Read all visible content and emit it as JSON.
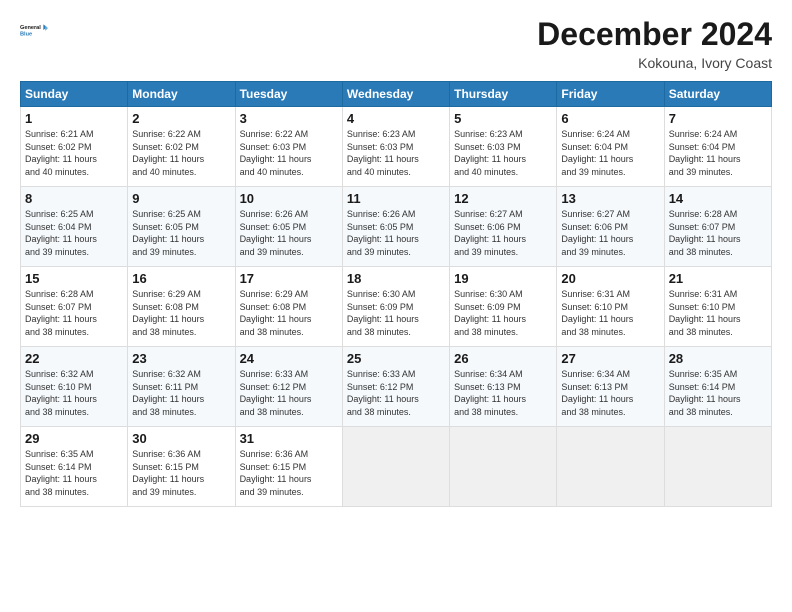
{
  "logo": {
    "line1": "General",
    "line2": "Blue"
  },
  "title": "December 2024",
  "subtitle": "Kokouna, Ivory Coast",
  "days_header": [
    "Sunday",
    "Monday",
    "Tuesday",
    "Wednesday",
    "Thursday",
    "Friday",
    "Saturday"
  ],
  "weeks": [
    [
      {
        "day": "1",
        "info": "Sunrise: 6:21 AM\nSunset: 6:02 PM\nDaylight: 11 hours\nand 40 minutes."
      },
      {
        "day": "2",
        "info": "Sunrise: 6:22 AM\nSunset: 6:02 PM\nDaylight: 11 hours\nand 40 minutes."
      },
      {
        "day": "3",
        "info": "Sunrise: 6:22 AM\nSunset: 6:03 PM\nDaylight: 11 hours\nand 40 minutes."
      },
      {
        "day": "4",
        "info": "Sunrise: 6:23 AM\nSunset: 6:03 PM\nDaylight: 11 hours\nand 40 minutes."
      },
      {
        "day": "5",
        "info": "Sunrise: 6:23 AM\nSunset: 6:03 PM\nDaylight: 11 hours\nand 40 minutes."
      },
      {
        "day": "6",
        "info": "Sunrise: 6:24 AM\nSunset: 6:04 PM\nDaylight: 11 hours\nand 39 minutes."
      },
      {
        "day": "7",
        "info": "Sunrise: 6:24 AM\nSunset: 6:04 PM\nDaylight: 11 hours\nand 39 minutes."
      }
    ],
    [
      {
        "day": "8",
        "info": "Sunrise: 6:25 AM\nSunset: 6:04 PM\nDaylight: 11 hours\nand 39 minutes."
      },
      {
        "day": "9",
        "info": "Sunrise: 6:25 AM\nSunset: 6:05 PM\nDaylight: 11 hours\nand 39 minutes."
      },
      {
        "day": "10",
        "info": "Sunrise: 6:26 AM\nSunset: 6:05 PM\nDaylight: 11 hours\nand 39 minutes."
      },
      {
        "day": "11",
        "info": "Sunrise: 6:26 AM\nSunset: 6:05 PM\nDaylight: 11 hours\nand 39 minutes."
      },
      {
        "day": "12",
        "info": "Sunrise: 6:27 AM\nSunset: 6:06 PM\nDaylight: 11 hours\nand 39 minutes."
      },
      {
        "day": "13",
        "info": "Sunrise: 6:27 AM\nSunset: 6:06 PM\nDaylight: 11 hours\nand 39 minutes."
      },
      {
        "day": "14",
        "info": "Sunrise: 6:28 AM\nSunset: 6:07 PM\nDaylight: 11 hours\nand 38 minutes."
      }
    ],
    [
      {
        "day": "15",
        "info": "Sunrise: 6:28 AM\nSunset: 6:07 PM\nDaylight: 11 hours\nand 38 minutes."
      },
      {
        "day": "16",
        "info": "Sunrise: 6:29 AM\nSunset: 6:08 PM\nDaylight: 11 hours\nand 38 minutes."
      },
      {
        "day": "17",
        "info": "Sunrise: 6:29 AM\nSunset: 6:08 PM\nDaylight: 11 hours\nand 38 minutes."
      },
      {
        "day": "18",
        "info": "Sunrise: 6:30 AM\nSunset: 6:09 PM\nDaylight: 11 hours\nand 38 minutes."
      },
      {
        "day": "19",
        "info": "Sunrise: 6:30 AM\nSunset: 6:09 PM\nDaylight: 11 hours\nand 38 minutes."
      },
      {
        "day": "20",
        "info": "Sunrise: 6:31 AM\nSunset: 6:10 PM\nDaylight: 11 hours\nand 38 minutes."
      },
      {
        "day": "21",
        "info": "Sunrise: 6:31 AM\nSunset: 6:10 PM\nDaylight: 11 hours\nand 38 minutes."
      }
    ],
    [
      {
        "day": "22",
        "info": "Sunrise: 6:32 AM\nSunset: 6:10 PM\nDaylight: 11 hours\nand 38 minutes."
      },
      {
        "day": "23",
        "info": "Sunrise: 6:32 AM\nSunset: 6:11 PM\nDaylight: 11 hours\nand 38 minutes."
      },
      {
        "day": "24",
        "info": "Sunrise: 6:33 AM\nSunset: 6:12 PM\nDaylight: 11 hours\nand 38 minutes."
      },
      {
        "day": "25",
        "info": "Sunrise: 6:33 AM\nSunset: 6:12 PM\nDaylight: 11 hours\nand 38 minutes."
      },
      {
        "day": "26",
        "info": "Sunrise: 6:34 AM\nSunset: 6:13 PM\nDaylight: 11 hours\nand 38 minutes."
      },
      {
        "day": "27",
        "info": "Sunrise: 6:34 AM\nSunset: 6:13 PM\nDaylight: 11 hours\nand 38 minutes."
      },
      {
        "day": "28",
        "info": "Sunrise: 6:35 AM\nSunset: 6:14 PM\nDaylight: 11 hours\nand 38 minutes."
      }
    ],
    [
      {
        "day": "29",
        "info": "Sunrise: 6:35 AM\nSunset: 6:14 PM\nDaylight: 11 hours\nand 38 minutes."
      },
      {
        "day": "30",
        "info": "Sunrise: 6:36 AM\nSunset: 6:15 PM\nDaylight: 11 hours\nand 39 minutes."
      },
      {
        "day": "31",
        "info": "Sunrise: 6:36 AM\nSunset: 6:15 PM\nDaylight: 11 hours\nand 39 minutes."
      },
      {
        "day": "",
        "info": ""
      },
      {
        "day": "",
        "info": ""
      },
      {
        "day": "",
        "info": ""
      },
      {
        "day": "",
        "info": ""
      }
    ]
  ]
}
